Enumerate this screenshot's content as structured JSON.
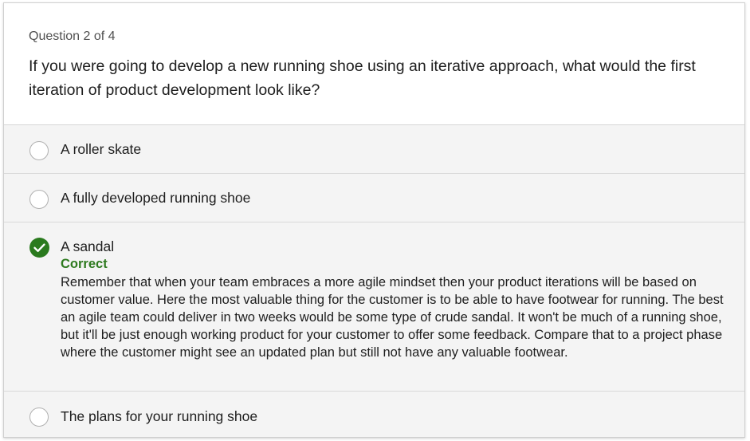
{
  "quiz": {
    "counter": "Question 2 of 4",
    "question": "If you were going to develop a new running shoe using an iterative approach, what would the first iteration of product development look like?"
  },
  "options": [
    {
      "label": "A roller skate",
      "state": "unselected"
    },
    {
      "label": "A fully developed running shoe",
      "state": "unselected"
    },
    {
      "label": "A sandal",
      "state": "correct",
      "feedback_title": "Correct",
      "feedback": "Remember that when your team embraces a more agile mindset then your product iterations will be based on customer value. Here the most valuable thing for the customer is to be able to have footwear for running. The best an agile team could deliver in two weeks would be some type of crude sandal. It won't be much of a running shoe, but it'll be just enough working product for your customer to offer some feedback. Compare that to a project phase where the customer might see an updated plan but still not have any valuable footwear."
    },
    {
      "label": "The plans for your running shoe",
      "state": "unselected"
    }
  ],
  "colors": {
    "correct_green": "#2e7a1f",
    "option_background": "#f4f4f4"
  },
  "icons": {
    "correct": "checkmark-circle-icon",
    "unselected": "radio-circle-icon"
  }
}
